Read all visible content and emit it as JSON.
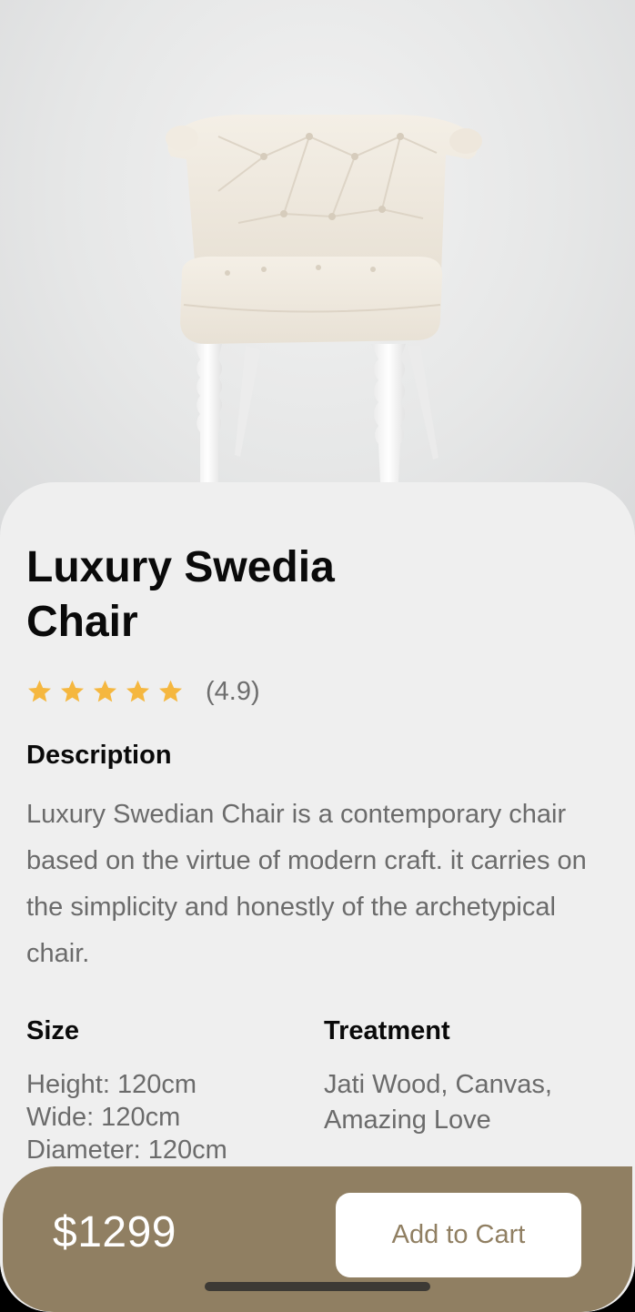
{
  "product": {
    "title": "Luxury Swedia Chair",
    "rating_text": "(4.9)",
    "star_count": 5,
    "rating_value": 4.9
  },
  "description": {
    "heading": "Description",
    "body": "Luxury Swedian Chair is a contemporary chair based on the virtue of modern craft. it carries on the simplicity and honestly of the archetypical chair."
  },
  "size": {
    "heading": "Size",
    "lines": [
      "Height: 120cm",
      "Wide: 120cm",
      "Diameter: 120cm"
    ]
  },
  "treatment": {
    "heading": "Treatment",
    "text": "Jati Wood, Canvas, Amazing Love"
  },
  "checkout": {
    "price": "$1299",
    "add_to_cart_label": "Add to Cart"
  },
  "colors": {
    "accent": "#907f62",
    "star": "#f5b73f",
    "sheet": "#efefef"
  },
  "icons": {
    "star": "star-icon"
  }
}
